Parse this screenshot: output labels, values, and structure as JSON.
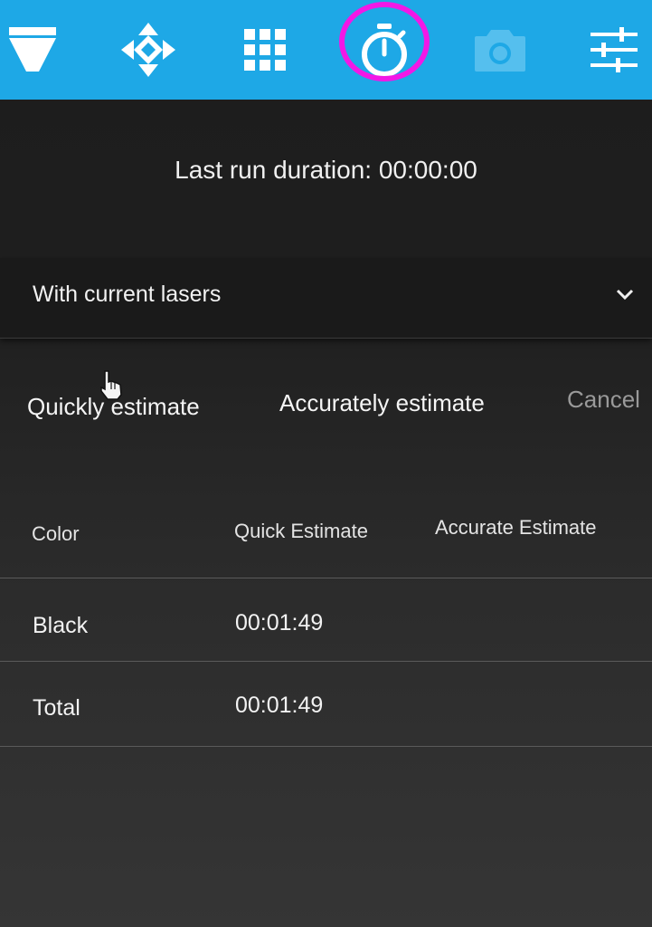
{
  "toolbar": {
    "tools": [
      {
        "icon": "funnel-icon",
        "active": false
      },
      {
        "icon": "move-arrows-icon",
        "active": false
      },
      {
        "icon": "grid-icon",
        "active": false
      },
      {
        "icon": "stopwatch-icon",
        "active": true
      },
      {
        "icon": "camera-icon",
        "active": false,
        "disabled": true
      },
      {
        "icon": "sliders-icon",
        "active": false
      }
    ],
    "colors": {
      "bar": "#1ea8e6",
      "icon": "#ffffff",
      "disabled_icon": "#55bfee",
      "highlight": "#f218e6"
    }
  },
  "status": {
    "last_run": "Last run duration: 00:00:00"
  },
  "section": {
    "title": "With current lasers"
  },
  "actions": {
    "quick": "Quickly estimate",
    "accurate": "Accurately estimate",
    "cancel": "Cancel"
  },
  "table": {
    "headers": {
      "color": "Color",
      "quick": "Quick Estimate",
      "accurate": "Accurate Estimate"
    },
    "rows": [
      {
        "color": "Black",
        "quick": "00:01:49",
        "accurate": ""
      },
      {
        "color": "Total",
        "quick": "00:01:49",
        "accurate": ""
      }
    ]
  }
}
